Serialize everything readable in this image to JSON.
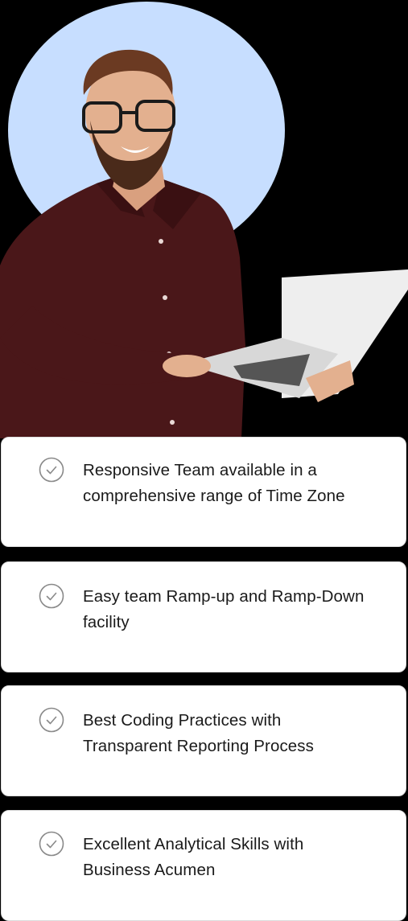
{
  "colors": {
    "page_background": "#000000",
    "circle_background": "#c7deff",
    "card_background": "#ffffff",
    "card_text": "#1a1a1a",
    "check_icon": "#8a8a8a",
    "shirt": "#4a1719"
  },
  "hero": {
    "image_alt": "Smiling man with glasses holding an open laptop"
  },
  "features": {
    "icon": "check-circle-icon",
    "items": [
      {
        "label": "Responsive Team available in a comprehensive range of Time Zone"
      },
      {
        "label": "Easy team Ramp-up and Ramp-Down facility"
      },
      {
        "label": "Best Coding Practices with Transparent Reporting Process"
      },
      {
        "label": "Excellent Analytical Skills with Business Acumen"
      }
    ]
  }
}
